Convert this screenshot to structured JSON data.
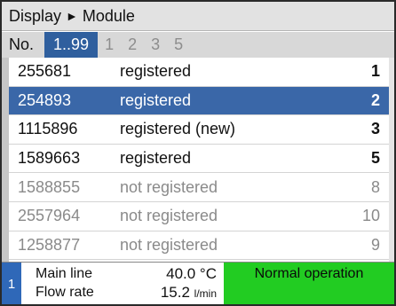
{
  "breadcrumb": {
    "first": "Display",
    "sep": "►",
    "second": "Module"
  },
  "filter": {
    "label": "No.",
    "options": [
      "1..99",
      "1",
      "2",
      "3",
      "5"
    ],
    "selected": 0
  },
  "modules": [
    {
      "id": "255681",
      "status": "registered",
      "number": "1",
      "state": "reg"
    },
    {
      "id": "254893",
      "status": "registered",
      "number": "2",
      "state": "reg",
      "selected": true
    },
    {
      "id": "1115896",
      "status": "registered (new)",
      "number": "3",
      "state": "reg"
    },
    {
      "id": "1589663",
      "status": "registered",
      "number": "5",
      "state": "reg"
    },
    {
      "id": "1588855",
      "status": "not registered",
      "number": "8",
      "state": "unreg"
    },
    {
      "id": "2557964",
      "status": "not registered",
      "number": "10",
      "state": "unreg"
    },
    {
      "id": "1258877",
      "status": "not registered",
      "number": "9",
      "state": "unreg"
    }
  ],
  "status_bar": {
    "channel": "1",
    "line1_label": "Main line",
    "line1_value": "40.0 °C",
    "line2_label": "Flow rate",
    "line2_value": "15.2 ",
    "line2_unit": "l/min",
    "operation": "Normal operation"
  },
  "colors": {
    "selection": "#3a67a8",
    "filter_selected": "#2f5f9e",
    "operation_bg": "#22cc22",
    "channel_bg": "#2f68b8"
  }
}
